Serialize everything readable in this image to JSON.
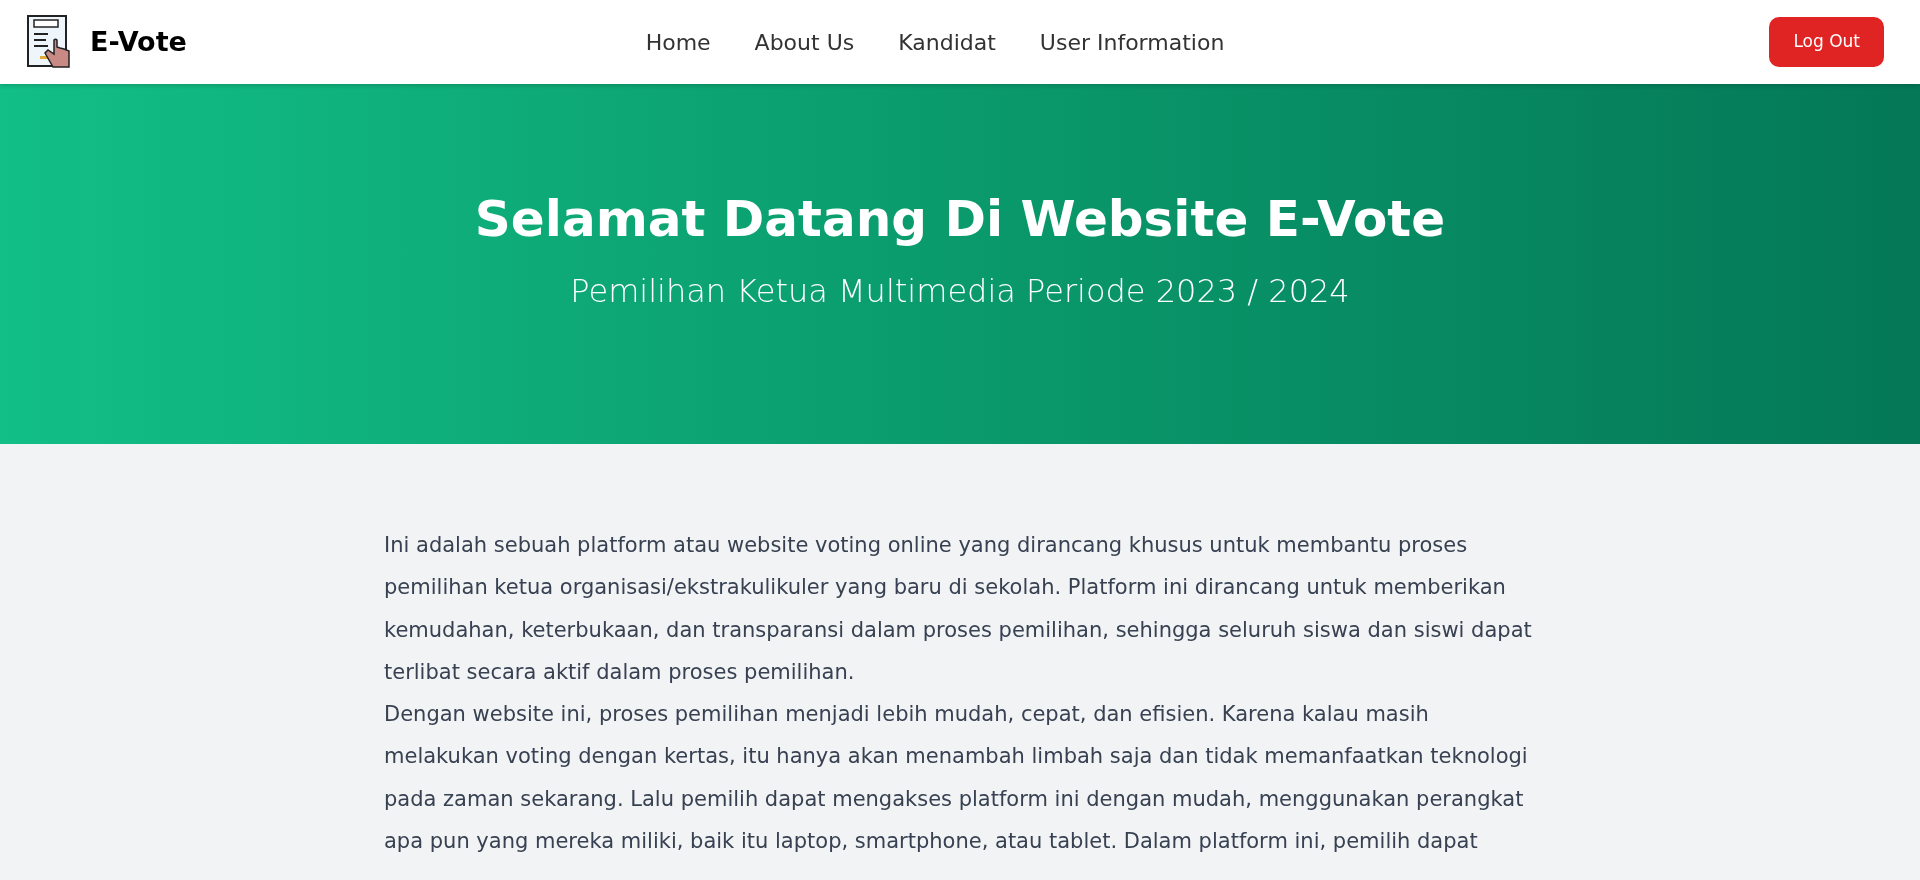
{
  "brand": {
    "name": "E-Vote"
  },
  "nav": [
    {
      "label": "Home"
    },
    {
      "label": "About Us"
    },
    {
      "label": "Kandidat"
    },
    {
      "label": "User Information"
    }
  ],
  "logout_button": {
    "label": "Log Out"
  },
  "hero": {
    "title": "Selamat Datang Di Website E-Vote",
    "subtitle": "Pemilihan Ketua Multimedia Periode 2023 / 2024"
  },
  "paragraphs": [
    "Ini adalah sebuah platform atau website voting online yang dirancang khusus untuk membantu proses pemilihan ketua organisasi/ekstrakulikuler yang baru di sekolah. Platform ini dirancang untuk memberikan kemudahan, keterbukaan, dan transparansi dalam proses pemilihan, sehingga seluruh siswa dan siswi dapat terlibat secara aktif dalam proses pemilihan.",
    "Dengan website ini, proses pemilihan menjadi lebih mudah, cepat, dan efisien. Karena kalau masih melakukan voting dengan kertas, itu hanya akan menambah limbah saja dan tidak memanfaatkan teknologi pada zaman sekarang. Lalu pemilih dapat mengakses platform ini dengan mudah, menggunakan perangkat apa pun yang mereka miliki, baik itu laptop, smartphone, atau tablet. Dalam platform ini, pemilih dapat"
  ]
}
